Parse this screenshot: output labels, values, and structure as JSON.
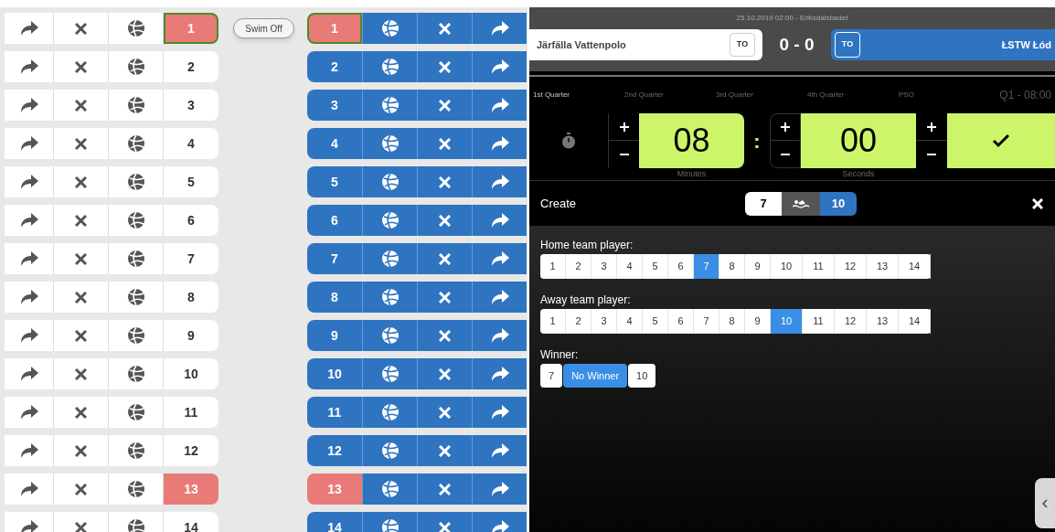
{
  "home_rows": [
    {
      "number": "1",
      "excluded": true,
      "selected": true
    },
    {
      "number": "2",
      "excluded": false,
      "selected": false
    },
    {
      "number": "3",
      "excluded": false,
      "selected": false
    },
    {
      "number": "4",
      "excluded": false,
      "selected": false
    },
    {
      "number": "5",
      "excluded": false,
      "selected": false
    },
    {
      "number": "6",
      "excluded": false,
      "selected": false
    },
    {
      "number": "7",
      "excluded": false,
      "selected": false
    },
    {
      "number": "8",
      "excluded": false,
      "selected": false
    },
    {
      "number": "9",
      "excluded": false,
      "selected": false
    },
    {
      "number": "10",
      "excluded": false,
      "selected": false
    },
    {
      "number": "11",
      "excluded": false,
      "selected": false
    },
    {
      "number": "12",
      "excluded": false,
      "selected": false
    },
    {
      "number": "13",
      "excluded": true,
      "selected": false
    },
    {
      "number": "14",
      "excluded": false,
      "selected": false
    }
  ],
  "swim_off_button": "Swim Off",
  "away_rows": [
    {
      "number": "1",
      "excluded": true,
      "selected": true
    },
    {
      "number": "2",
      "excluded": false,
      "selected": false
    },
    {
      "number": "3",
      "excluded": false,
      "selected": false
    },
    {
      "number": "4",
      "excluded": false,
      "selected": false
    },
    {
      "number": "5",
      "excluded": false,
      "selected": false
    },
    {
      "number": "6",
      "excluded": false,
      "selected": false
    },
    {
      "number": "7",
      "excluded": false,
      "selected": false
    },
    {
      "number": "8",
      "excluded": false,
      "selected": false
    },
    {
      "number": "9",
      "excluded": false,
      "selected": false
    },
    {
      "number": "10",
      "excluded": false,
      "selected": false
    },
    {
      "number": "11",
      "excluded": false,
      "selected": false
    },
    {
      "number": "12",
      "excluded": false,
      "selected": false
    },
    {
      "number": "13",
      "excluded": true,
      "selected": false
    },
    {
      "number": "14",
      "excluded": false,
      "selected": false
    }
  ],
  "match_info": "25.10.2019 02:00 - Eriksdalsbadet",
  "home_team": {
    "name": "Järfälla Vattenpolo",
    "timeout": "TO"
  },
  "score": "0 - 0",
  "away_team": {
    "name": "ŁSTW Łód",
    "timeout": "TO"
  },
  "quarters": [
    {
      "label": "1st Quarter",
      "selected": true
    },
    {
      "label": "2nd Quarter",
      "selected": false
    },
    {
      "label": "3rd Quarter",
      "selected": false
    },
    {
      "label": "4th Quarter",
      "selected": false
    },
    {
      "label": "PSO",
      "selected": false
    }
  ],
  "period_clock": "Q1 - 08:00",
  "timer": {
    "minutes": "08",
    "separator": ":",
    "seconds": "00",
    "minutes_label": "Minutes",
    "seconds_label": "Seconds"
  },
  "swim_off_panel": {
    "title": "Create",
    "home_number": "7",
    "away_number": "10"
  },
  "home_player_label": "Home team player:",
  "home_players": [
    {
      "label": "1",
      "selected": false
    },
    {
      "label": "2",
      "selected": false
    },
    {
      "label": "3",
      "selected": false
    },
    {
      "label": "4",
      "selected": false
    },
    {
      "label": "5",
      "selected": false
    },
    {
      "label": "6",
      "selected": false
    },
    {
      "label": "7",
      "selected": true
    },
    {
      "label": "8",
      "selected": false
    },
    {
      "label": "9",
      "selected": false
    },
    {
      "label": "10",
      "selected": false
    },
    {
      "label": "11",
      "selected": false
    },
    {
      "label": "12",
      "selected": false
    },
    {
      "label": "13",
      "selected": false
    },
    {
      "label": "14",
      "selected": false
    }
  ],
  "away_player_label": "Away team player:",
  "away_players": [
    {
      "label": "1",
      "selected": false
    },
    {
      "label": "2",
      "selected": false
    },
    {
      "label": "3",
      "selected": false
    },
    {
      "label": "4",
      "selected": false
    },
    {
      "label": "5",
      "selected": false
    },
    {
      "label": "6",
      "selected": false
    },
    {
      "label": "7",
      "selected": false
    },
    {
      "label": "8",
      "selected": false
    },
    {
      "label": "9",
      "selected": false
    },
    {
      "label": "10",
      "selected": true
    },
    {
      "label": "11",
      "selected": false
    },
    {
      "label": "12",
      "selected": false
    },
    {
      "label": "13",
      "selected": false
    },
    {
      "label": "14",
      "selected": false
    }
  ],
  "winner_label": "Winner:",
  "winner_options": [
    {
      "label": "7",
      "selected": false
    },
    {
      "label": "No Winner",
      "selected": true
    },
    {
      "label": "10",
      "selected": false
    }
  ]
}
